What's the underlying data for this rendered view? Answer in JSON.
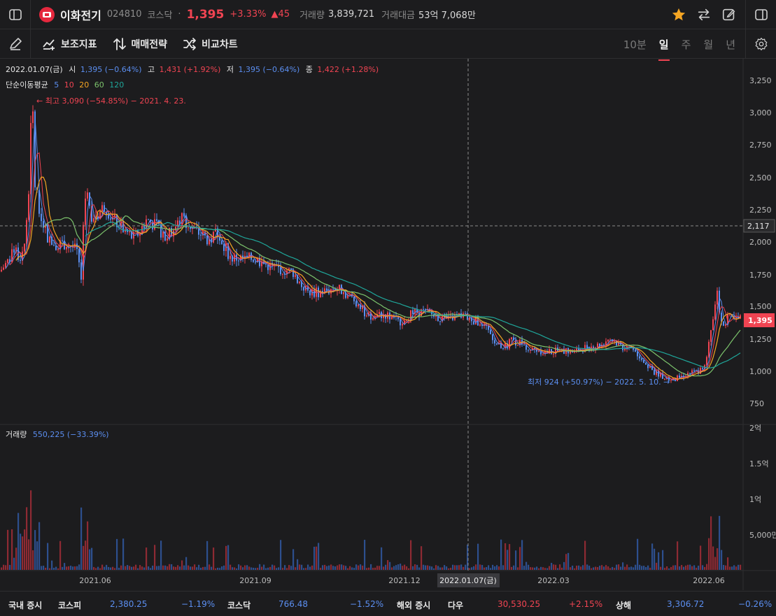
{
  "header": {
    "stock_name": "이화전기",
    "code": "024810",
    "market": "코스닥",
    "dot": "·",
    "price": "1,395",
    "change_pct": "+3.33%",
    "change_abs": "▲45",
    "volume_label": "거래량",
    "volume_value": "3,839,721",
    "amount_label": "거래대금",
    "amount_value": "53억 7,068만"
  },
  "toolbar": {
    "indicator_label": "보조지표",
    "strategy_label": "매매전략",
    "compare_label": "비교차트",
    "periods": [
      "10분",
      "일",
      "주",
      "월",
      "년"
    ],
    "active_period": "일"
  },
  "chart": {
    "ohlc_info": {
      "date": "2022.01.07(금)",
      "open_label": "시",
      "open_value": "1,395 (−0.64%)",
      "high_label": "고",
      "high_value": "1,431 (+1.92%)",
      "low_label": "저",
      "low_value": "1,395 (−0.64%)",
      "close_label": "종",
      "close_value": "1,422 (+1.28%)"
    },
    "ma_label": "단순이동평균",
    "ma_periods": [
      "5",
      "10",
      "20",
      "60",
      "120"
    ],
    "ma_colors": [
      "#5b8ef0",
      "#f04452",
      "#f5a623",
      "#7cc36c",
      "#1fa69a"
    ],
    "max_annotation": "← 최고 3,090 (−54.85%) − 2021. 4. 23.",
    "min_annotation": "최저 924 (+50.97%) − 2022. 5. 10. →",
    "y_ticks": [
      "3,250",
      "3,000",
      "2,750",
      "2,500",
      "2,250",
      "2,000",
      "1,750",
      "1,500",
      "1,250",
      "1,000",
      "750"
    ],
    "crosshair_price": "2,117",
    "current_price_tag": "1,395",
    "volume_info_label": "거래량",
    "volume_info_value": "550,225 (−33.39%)",
    "volume_ticks": [
      "2억",
      "1.5억",
      "1억",
      "5,000만"
    ],
    "x_ticks": [
      "2021.06",
      "2021.09",
      "2021.12",
      "2022.03",
      "2022.06"
    ],
    "crosshair_date": "2022.01.07(금)",
    "up_color": "#f04452",
    "down_color": "#5b8ef0"
  },
  "chart_data": {
    "type": "candlestick",
    "title": "",
    "ylim": [
      600,
      3350
    ],
    "x_range": [
      "2021-04",
      "2022-06"
    ],
    "series": [
      {
        "points": [
          [
            0,
            1750
          ],
          [
            10,
            1820
          ],
          [
            20,
            1900
          ],
          [
            30,
            1850
          ],
          [
            40,
            2150
          ],
          [
            44,
            2900
          ],
          [
            46,
            3090
          ],
          [
            50,
            2400
          ],
          [
            55,
            2250
          ],
          [
            60,
            2150
          ],
          [
            70,
            1980
          ],
          [
            80,
            1960
          ],
          [
            90,
            1960
          ],
          [
            100,
            1950
          ],
          [
            110,
            1900
          ],
          [
            116,
            1650
          ],
          [
            120,
            2250
          ],
          [
            125,
            2380
          ],
          [
            130,
            2150
          ],
          [
            140,
            2180
          ],
          [
            150,
            2250
          ],
          [
            160,
            2150
          ],
          [
            170,
            2100
          ],
          [
            180,
            2050
          ],
          [
            190,
            2000
          ],
          [
            200,
            2050
          ],
          [
            210,
            2150
          ],
          [
            220,
            2100
          ],
          [
            230,
            2050
          ],
          [
            240,
            2020
          ],
          [
            250,
            2080
          ],
          [
            260,
            2150
          ],
          [
            270,
            2100
          ],
          [
            280,
            2050
          ],
          [
            290,
            2020
          ],
          [
            300,
            1980
          ],
          [
            310,
            2050
          ],
          [
            320,
            1950
          ],
          [
            330,
            1850
          ],
          [
            340,
            1850
          ],
          [
            350,
            1840
          ],
          [
            360,
            1850
          ],
          [
            370,
            1830
          ],
          [
            380,
            1800
          ],
          [
            390,
            1780
          ],
          [
            400,
            1770
          ],
          [
            410,
            1760
          ],
          [
            420,
            1740
          ],
          [
            430,
            1650
          ],
          [
            440,
            1600
          ],
          [
            450,
            1590
          ],
          [
            460,
            1600
          ],
          [
            470,
            1610
          ],
          [
            480,
            1630
          ],
          [
            490,
            1600
          ],
          [
            500,
            1560
          ],
          [
            510,
            1520
          ],
          [
            520,
            1450
          ],
          [
            530,
            1400
          ],
          [
            540,
            1420
          ],
          [
            550,
            1430
          ],
          [
            560,
            1400
          ],
          [
            570,
            1370
          ],
          [
            580,
            1410
          ],
          [
            590,
            1440
          ],
          [
            600,
            1450
          ],
          [
            610,
            1440
          ],
          [
            620,
            1420
          ],
          [
            630,
            1400
          ],
          [
            640,
            1390
          ],
          [
            650,
            1410
          ],
          [
            660,
            1420
          ],
          [
            670,
            1400
          ],
          [
            680,
            1380
          ],
          [
            690,
            1330
          ],
          [
            700,
            1290
          ],
          [
            710,
            1200
          ],
          [
            720,
            1170
          ],
          [
            730,
            1230
          ],
          [
            740,
            1220
          ],
          [
            750,
            1180
          ],
          [
            760,
            1160
          ],
          [
            770,
            1160
          ],
          [
            780,
            1140
          ],
          [
            790,
            1150
          ],
          [
            800,
            1150
          ],
          [
            810,
            1150
          ],
          [
            820,
            1140
          ],
          [
            830,
            1170
          ],
          [
            840,
            1180
          ],
          [
            850,
            1190
          ],
          [
            860,
            1200
          ],
          [
            870,
            1250
          ],
          [
            880,
            1220
          ],
          [
            890,
            1180
          ],
          [
            900,
            1180
          ],
          [
            910,
            1140
          ],
          [
            920,
            1080
          ],
          [
            930,
            1010
          ],
          [
            940,
            980
          ],
          [
            950,
            960
          ],
          [
            960,
            924
          ],
          [
            970,
            950
          ],
          [
            980,
            980
          ],
          [
            990,
            990
          ],
          [
            1000,
            1000
          ],
          [
            1010,
            1100
          ],
          [
            1020,
            1450
          ],
          [
            1025,
            1580
          ],
          [
            1030,
            1350
          ],
          [
            1040,
            1400
          ],
          [
            1050,
            1380
          ],
          [
            1058,
            1395
          ]
        ]
      }
    ],
    "moving_averages": [
      "5",
      "10",
      "20",
      "60",
      "120"
    ]
  },
  "footer": {
    "domestic_label": "국내 증시",
    "kospi_label": "코스피",
    "kospi_value": "2,380.25",
    "kospi_change": "−1.19%",
    "kosdaq_label": "코스닥",
    "kosdaq_value": "766.48",
    "kosdaq_change": "−1.52%",
    "overseas_label": "해외 증시",
    "dow_label": "다우",
    "dow_value": "30,530.25",
    "dow_change": "+2.15%",
    "shanghai_label": "상해",
    "shanghai_value": "3,306.72",
    "shanghai_change": "−0.26%"
  }
}
